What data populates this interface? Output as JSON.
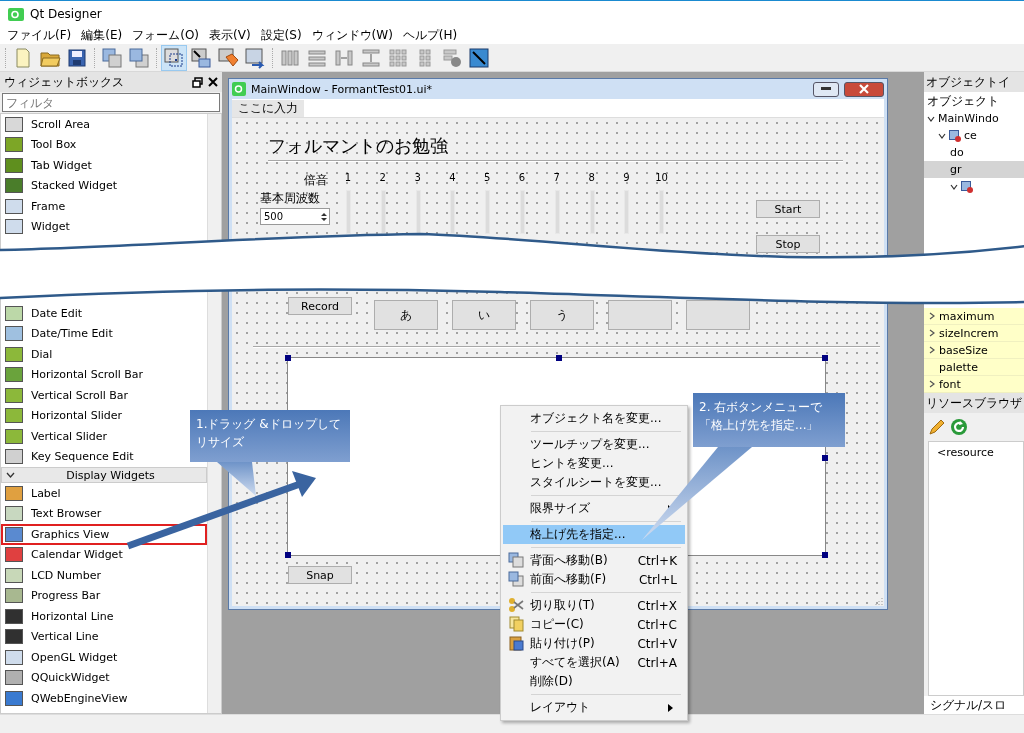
{
  "app": {
    "title": "Qt Designer"
  },
  "menu": [
    "ファイル(F)",
    "編集(E)",
    "フォーム(O)",
    "表示(V)",
    "設定(S)",
    "ウィンドウ(W)",
    "ヘルプ(H)"
  ],
  "toolbar": [
    [
      {
        "kind": "new",
        "selected": false
      },
      {
        "kind": "open",
        "selected": false
      },
      {
        "kind": "save",
        "selected": false
      }
    ],
    [
      {
        "kind": "back",
        "selected": false
      },
      {
        "kind": "front",
        "selected": false
      }
    ],
    [
      {
        "kind": "widgets",
        "selected": true
      },
      {
        "kind": "signals",
        "selected": false
      },
      {
        "kind": "buddies",
        "selected": false
      },
      {
        "kind": "taborder",
        "selected": false
      }
    ],
    [
      {
        "kind": "hbox",
        "selected": false
      },
      {
        "kind": "vbox",
        "selected": false
      },
      {
        "kind": "hsplit",
        "selected": false
      },
      {
        "kind": "vsplit",
        "selected": false
      },
      {
        "kind": "grid",
        "selected": false
      },
      {
        "kind": "form",
        "selected": false
      },
      {
        "kind": "break",
        "selected": false
      },
      {
        "kind": "adjust",
        "selected": false
      }
    ]
  ],
  "widget_box": {
    "title": "ウィジェットボックス",
    "filter": {
      "placeholder": "フィルタ"
    },
    "items_top": [
      {
        "label": "Scroll Area",
        "highlighted": false
      },
      {
        "label": "Tool Box",
        "highlighted": false
      },
      {
        "label": "Tab Widget",
        "highlighted": false
      },
      {
        "label": "Stacked Widget",
        "highlighted": false
      },
      {
        "label": "Frame",
        "highlighted": false
      },
      {
        "label": "Widget",
        "highlighted": false
      }
    ],
    "items_middle": [
      {
        "label": "Date Edit",
        "highlighted": false
      },
      {
        "label": "Date/Time Edit",
        "highlighted": false
      },
      {
        "label": "Dial",
        "highlighted": false
      },
      {
        "label": "Horizontal Scroll Bar",
        "highlighted": false
      },
      {
        "label": "Vertical Scroll Bar",
        "highlighted": false
      },
      {
        "label": "Horizontal Slider",
        "highlighted": false
      },
      {
        "label": "Vertical Slider",
        "highlighted": false
      },
      {
        "label": "Key Sequence Edit",
        "highlighted": false
      }
    ],
    "category": {
      "label": "Display Widgets",
      "expanded": true
    },
    "items_display": [
      {
        "label": "Label",
        "highlighted": false
      },
      {
        "label": "Text Browser",
        "highlighted": false
      },
      {
        "label": "Graphics View",
        "highlighted": true
      },
      {
        "label": "Calendar Widget",
        "highlighted": false
      },
      {
        "label": "LCD Number",
        "highlighted": false
      },
      {
        "label": "Progress Bar",
        "highlighted": false
      },
      {
        "label": "Horizontal Line",
        "highlighted": false
      },
      {
        "label": "Vertical Line",
        "highlighted": false
      },
      {
        "label": "OpenGL Widget",
        "highlighted": false
      },
      {
        "label": "QQuickWidget",
        "highlighted": false
      },
      {
        "label": "QWebEngineView",
        "highlighted": false
      }
    ]
  },
  "form_window": {
    "title": "MainWindow - FormantTest01.ui*",
    "menu_placeholder": "ここに入力",
    "heading": "フォルマントのお勉強",
    "harmonics_label": "倍音",
    "harmonics": [
      "1",
      "2",
      "3",
      "4",
      "5",
      "6",
      "7",
      "8",
      "9",
      "10"
    ],
    "base_freq_label": "基本周波数",
    "base_freq_value": "500",
    "start": "Start",
    "stop": "Stop",
    "record": "Record",
    "vowels": [
      "あ",
      "い",
      "う"
    ],
    "snap": "Snap",
    "graphics_view": {
      "selected": true
    }
  },
  "context_menu": {
    "groups": [
      [
        {
          "label": "オブジェクト名を変更...",
          "kind": "plain",
          "selected": false,
          "submenu": false
        }
      ],
      [
        {
          "label": "ツールチップを変更...",
          "kind": "plain",
          "selected": false,
          "submenu": false
        },
        {
          "label": "ヒントを変更...",
          "kind": "plain",
          "selected": false,
          "submenu": false
        },
        {
          "label": "スタイルシートを変更...",
          "kind": "plain",
          "selected": false,
          "submenu": false
        }
      ],
      [
        {
          "label": "限界サイズ",
          "kind": "plain",
          "selected": false,
          "submenu": true
        }
      ],
      [
        {
          "label": "格上げ先を指定...",
          "kind": "plain",
          "selected": true,
          "submenu": false
        }
      ],
      [
        {
          "label": "背面へ移動(B)",
          "shortcut": "Ctrl+K",
          "kind": "back",
          "selected": false,
          "submenu": false
        },
        {
          "label": "前面へ移動(F)",
          "shortcut": "Ctrl+L",
          "kind": "front",
          "selected": false,
          "submenu": false
        }
      ],
      [
        {
          "label": "切り取り(T)",
          "shortcut": "Ctrl+X",
          "kind": "cut",
          "selected": false,
          "submenu": false
        },
        {
          "label": "コピー(C)",
          "shortcut": "Ctrl+C",
          "kind": "copy",
          "selected": false,
          "submenu": false
        },
        {
          "label": "貼り付け(P)",
          "shortcut": "Ctrl+V",
          "kind": "paste",
          "selected": false,
          "submenu": false
        },
        {
          "label": "すべてを選択(A)",
          "shortcut": "Ctrl+A",
          "kind": "plain",
          "selected": false,
          "submenu": false
        },
        {
          "label": "削除(D)",
          "kind": "plain",
          "selected": false,
          "submenu": false
        }
      ],
      [
        {
          "label": "レイアウト",
          "kind": "plain",
          "selected": false,
          "submenu": true
        }
      ]
    ]
  },
  "callouts": [
    {
      "lines": [
        "1.ドラッグ &ドロップして",
        "リサイズ"
      ]
    },
    {
      "lines": [
        "2. 右ボタンメニューで",
        "「格上げ先を指定...」"
      ]
    }
  ],
  "object_inspector": {
    "title": "オブジェクトイ",
    "column": "オブジェクト",
    "tree": [
      {
        "label": "MainWindo",
        "expanded": true,
        "selected": false,
        "children": [
          {
            "label": "ce",
            "icon": true,
            "expanded": true,
            "selected": false,
            "children": [
              {
                "label": "do",
                "selected": false
              },
              {
                "label": "gr",
                "selected": true
              },
              {
                "icon": true,
                "expanded": true,
                "selected": false
              }
            ]
          }
        ]
      }
    ]
  },
  "properties": [
    {
      "label": "maximum",
      "expandable": true
    },
    {
      "label": "sizeIncrem",
      "expandable": true
    },
    {
      "label": "baseSize",
      "expandable": true
    },
    {
      "label": "palette",
      "expandable": false
    },
    {
      "label": "font",
      "expandable": true
    }
  ],
  "resource_browser": {
    "title": "リソースブラウザ",
    "root": "<resource"
  },
  "bottom_tab": "シグナル/スロ"
}
